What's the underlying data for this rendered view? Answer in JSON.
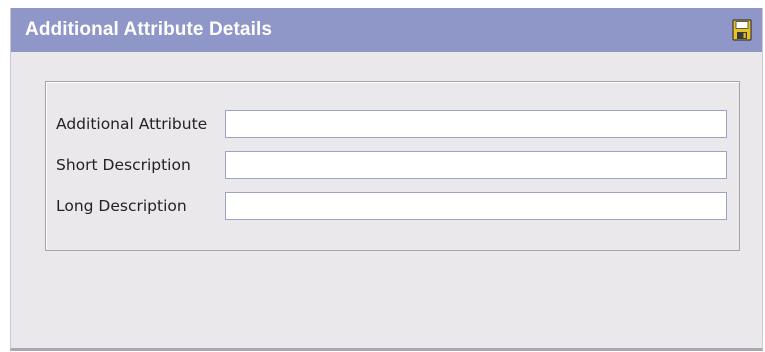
{
  "panel": {
    "title": "Additional Attribute Details",
    "save_icon": "save-icon"
  },
  "form": {
    "fields": [
      {
        "label": "Additional Attribute",
        "value": "",
        "placeholder": ""
      },
      {
        "label": "Short Description",
        "value": "",
        "placeholder": ""
      },
      {
        "label": "Long Description",
        "value": "",
        "placeholder": ""
      }
    ]
  },
  "colors": {
    "titlebar": "#8f96c8",
    "panel_bg": "#ebe8ec",
    "input_border": "#9da3c8"
  }
}
